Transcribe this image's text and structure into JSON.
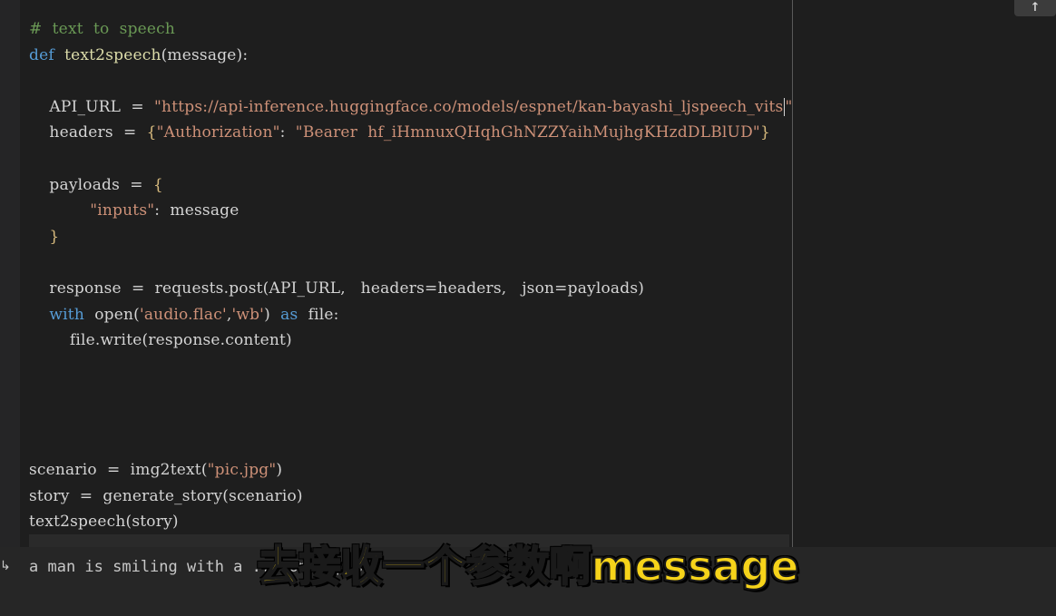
{
  "code_lines": [
    {
      "indent": "",
      "parts": [
        {
          "cls": "comment",
          "text": "#  text  to  speech"
        }
      ]
    },
    {
      "indent": "",
      "parts": [
        {
          "cls": "kw",
          "text": "def"
        },
        {
          "cls": "",
          "text": "  "
        },
        {
          "cls": "fn",
          "text": "text2speech"
        },
        {
          "cls": "",
          "text": "(message):"
        }
      ]
    },
    {
      "indent": "",
      "parts": []
    },
    {
      "indent": "    ",
      "parts": [
        {
          "cls": "",
          "text": "API_URL  =  "
        },
        {
          "cls": "str",
          "text": "\"https://api-inference.huggingface.co/models/espnet/kan-bayashi_ljspeech_vits"
        },
        {
          "cls": "caret",
          "text": ""
        },
        {
          "cls": "str",
          "text": "\""
        }
      ]
    },
    {
      "indent": "    ",
      "parts": [
        {
          "cls": "",
          "text": "headers  =  "
        },
        {
          "cls": "brace",
          "text": "{"
        },
        {
          "cls": "str",
          "text": "\"Authorization\""
        },
        {
          "cls": "",
          "text": ":  "
        },
        {
          "cls": "str",
          "text": "\"Bearer  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\""
        },
        {
          "cls": "brace",
          "text": "}"
        }
      ]
    },
    {
      "indent": "",
      "parts": []
    },
    {
      "indent": "    ",
      "parts": [
        {
          "cls": "",
          "text": "payloads  =  "
        },
        {
          "cls": "brace",
          "text": "{"
        }
      ]
    },
    {
      "indent": "            ",
      "parts": [
        {
          "cls": "str",
          "text": "\"inputs\""
        },
        {
          "cls": "",
          "text": ":  message"
        }
      ]
    },
    {
      "indent": "    ",
      "parts": [
        {
          "cls": "brace",
          "text": "}"
        }
      ]
    },
    {
      "indent": "",
      "parts": []
    },
    {
      "indent": "    ",
      "parts": [
        {
          "cls": "",
          "text": "response  =  requests.post(API_URL,   headers=headers,   json=payloads)"
        }
      ]
    },
    {
      "indent": "    ",
      "parts": [
        {
          "cls": "kw",
          "text": "with"
        },
        {
          "cls": "",
          "text": "  open("
        },
        {
          "cls": "str",
          "text": "'audio.flac'"
        },
        {
          "cls": "",
          "text": ","
        },
        {
          "cls": "str",
          "text": "'wb'"
        },
        {
          "cls": "",
          "text": ")  "
        },
        {
          "cls": "kw",
          "text": "as"
        },
        {
          "cls": "",
          "text": "  file:"
        }
      ]
    },
    {
      "indent": "        ",
      "parts": [
        {
          "cls": "",
          "text": "file.write(response.content)"
        }
      ]
    },
    {
      "indent": "",
      "parts": []
    },
    {
      "indent": "",
      "parts": []
    },
    {
      "indent": "",
      "parts": []
    },
    {
      "indent": "",
      "parts": []
    },
    {
      "indent": "",
      "parts": [
        {
          "cls": "",
          "text": "scenario  =  img2text("
        },
        {
          "cls": "str",
          "text": "\"pic.jpg\""
        },
        {
          "cls": "",
          "text": ")"
        }
      ]
    },
    {
      "indent": "",
      "parts": [
        {
          "cls": "",
          "text": "story  =  generate_story(scenario)"
        }
      ]
    },
    {
      "indent": "",
      "parts": [
        {
          "cls": "",
          "text": "text2speech(story)"
        }
      ]
    }
  ],
  "output": {
    "arrow": "↳",
    "text": "a man is smiling with a ... on a pipe"
  },
  "subtitle": "去接收一个参数啊message",
  "scroll_top_icon": "↑"
}
